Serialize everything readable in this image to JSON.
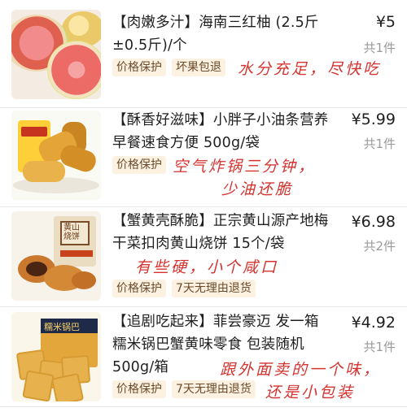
{
  "items": [
    {
      "title": "【肉嫩多汁】海南三红柚 (2.5斤±0.5斤)/个",
      "price": "¥5",
      "quantity": "共1件",
      "tags": [
        "价格保护",
        "坏果包退"
      ],
      "note": [
        "水分充足，尽快吃"
      ],
      "image": "pomelo-image"
    },
    {
      "title": "【酥香好滋味】小胖子小油条营养早餐速食方便 500g/袋",
      "price": "¥5.99",
      "quantity": "共1件",
      "tags": [
        "价格保护"
      ],
      "note": [
        "空气炸锅三分钟，",
        "少油还脆"
      ],
      "image": "youtiao-image"
    },
    {
      "title": "【蟹黄壳酥脆】正宗黄山源产地梅干菜扣肉黄山烧饼 15个/袋",
      "price": "¥6.98",
      "quantity": "共2件",
      "tags": [
        "价格保护",
        "7天无理由退货"
      ],
      "note": [
        "有些硬，小个咸口"
      ],
      "image": "shaobing-image",
      "package_label": "黄山烧饼"
    },
    {
      "title": "【追剧吃起来】菲尝豪迈 发一箱 糯米锅巴蟹黄味零食 包装随机 500g/箱",
      "price": "¥4.92",
      "quantity": "共1件",
      "tags": [
        "价格保护",
        "7天无理由退货"
      ],
      "note": [
        "跟外面卖的一个味，",
        "还是小包装"
      ],
      "image": "cracker-image",
      "package_label": "糯米锅巴"
    }
  ],
  "colors": {
    "tag_bg": "#fdf1e2",
    "tag_text": "#6b4a2a",
    "note": "#d4332f",
    "muted": "#9a9a9a"
  }
}
